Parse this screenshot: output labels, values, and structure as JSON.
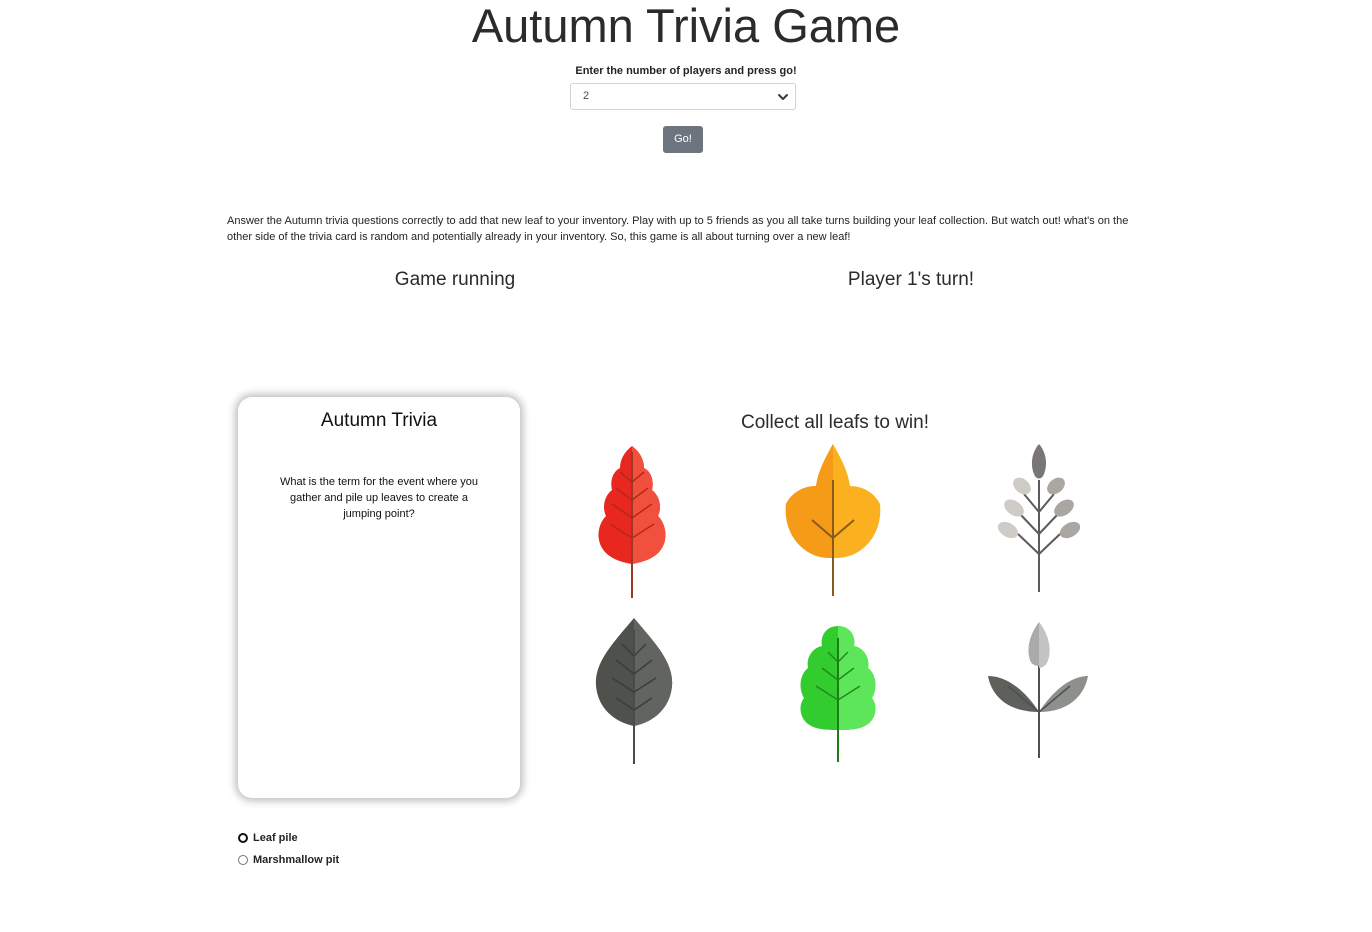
{
  "header": {
    "title": "Autumn Trivia Game"
  },
  "setup": {
    "prompt": "Enter the number of players and press go!",
    "players_selected": "2",
    "go_label": "Go!"
  },
  "intro": {
    "text": "Answer the Autumn trivia questions correctly to add that new leaf to your inventory. Play with up to 5 friends as you all take turns building your leaf collection. But watch out! what's on the other side of the trivia card is random and potentially already in your inventory. So, this game is all about turning over a new leaf!"
  },
  "status": {
    "game_state": "Game running",
    "turn": "Player 1's turn!"
  },
  "card": {
    "title": "Autumn Trivia",
    "question": "What is the term for the event where you gather and pile up leaves to create a jumping point?"
  },
  "collection": {
    "title": "Collect all leafs to win!",
    "leaves": [
      {
        "name": "red-leaf-icon",
        "color": "#e8281e"
      },
      {
        "name": "orange-leaf-icon",
        "color": "#f7a21b"
      },
      {
        "name": "grey-branch-icon",
        "color": "#b5b2ad"
      },
      {
        "name": "dark-leaf-icon",
        "color": "#5a5c57"
      },
      {
        "name": "green-leaf-icon",
        "color": "#37d137"
      },
      {
        "name": "grey-sprig-icon",
        "color": "#8d8f8b"
      }
    ]
  },
  "answers": [
    {
      "label": "Leaf pile"
    },
    {
      "label": "Marshmallow pit"
    }
  ]
}
